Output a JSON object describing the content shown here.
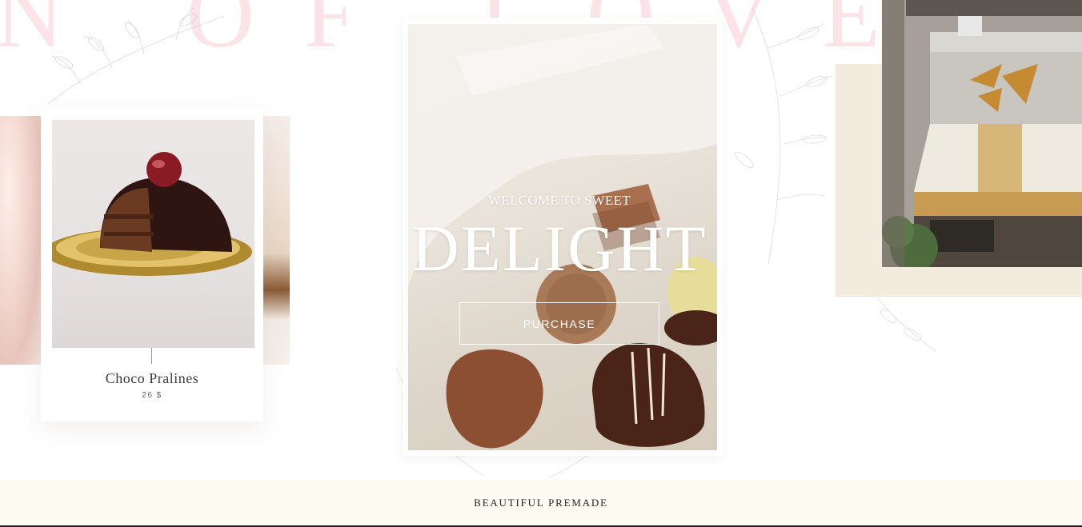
{
  "background_heading": "N OF LOVE",
  "product": {
    "name": "Choco Pralines",
    "price": "26 $"
  },
  "hero": {
    "subtitle": "WELCOME TO SWEET",
    "title": "DELIGHT",
    "button_label": "PURCHASE"
  },
  "band": {
    "text": "BEAUTIFUL PREMADE"
  },
  "colors": {
    "accent_pink": "#fbe3e8",
    "beige": "#f3ebdd",
    "band_bg": "#fdfaf1"
  }
}
